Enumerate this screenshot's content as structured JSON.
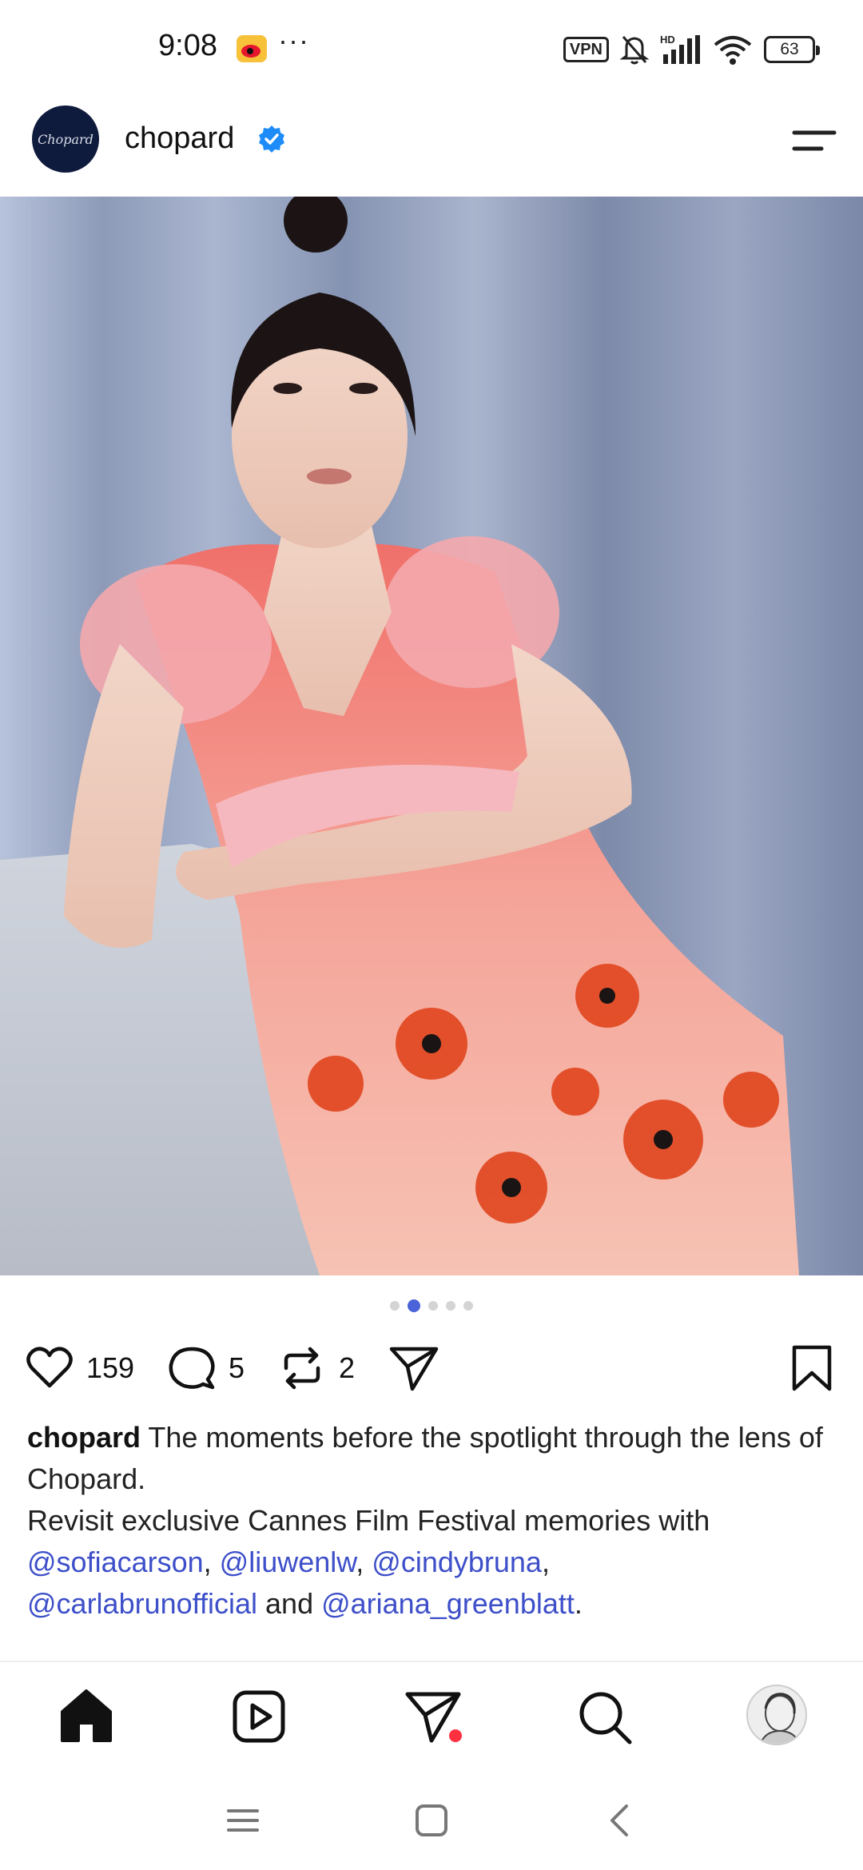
{
  "status_bar": {
    "time": "9:08",
    "more": "···",
    "vpn": "VPN",
    "battery": "63",
    "network_label": "HD"
  },
  "header": {
    "account_name": "chopard",
    "avatar_text": "Chopard"
  },
  "carousel": {
    "total": 5,
    "active_index": 1
  },
  "actions": {
    "likes": "159",
    "comments": "5",
    "reposts": "2"
  },
  "caption": {
    "username": "chopard",
    "line1": " The moments before the spotlight through the lens of Chopard.",
    "line2": "Revisit exclusive Cannes Film Festival memories with",
    "mention1": "@sofiacarson",
    "sep1": ", ",
    "mention2": "@liuwenlw",
    "sep2": ", ",
    "mention3": "@cindybruna",
    "sep3": ",",
    "mention4": "@carlabrunofficial",
    "and": " and ",
    "mention5": "@ariana_greenblatt",
    "end": "."
  },
  "colors": {
    "accent": "#3d4fc9",
    "verified": "#1d8cf8",
    "notification_dot": "#ff3040"
  }
}
